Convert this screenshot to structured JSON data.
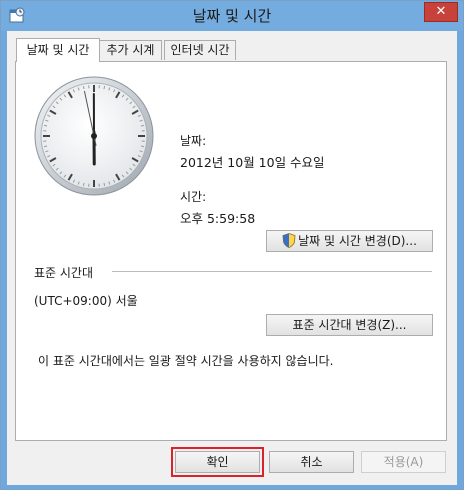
{
  "window": {
    "title": "날짜 및 시간"
  },
  "tabs": [
    {
      "label": "날짜 및 시간",
      "active": true
    },
    {
      "label": "추가 시계",
      "active": false
    },
    {
      "label": "인터넷 시간",
      "active": false
    }
  ],
  "datetime": {
    "date_label": "날짜:",
    "date_value": "2012년 10월 10일 수요일",
    "time_label": "시간:",
    "time_value": "오후 5:59:58",
    "change_button": "날짜 및 시간 변경(D)..."
  },
  "timezone": {
    "section_label": "표준 시간대",
    "value": "(UTC+09:00) 서울",
    "change_button": "표준 시간대 변경(Z)...",
    "dst_note": "이 표준 시간대에서는 일광 절약 시간을 사용하지 않습니다."
  },
  "footer": {
    "ok_button": "확인",
    "cancel_button": "취소",
    "apply_button": "적용(A)"
  },
  "clock": {
    "hour": 5,
    "minute": 59,
    "second": 58
  },
  "icons": {
    "app": "calendar-clock-icon",
    "close": "close-icon",
    "shield": "uac-shield-icon"
  }
}
